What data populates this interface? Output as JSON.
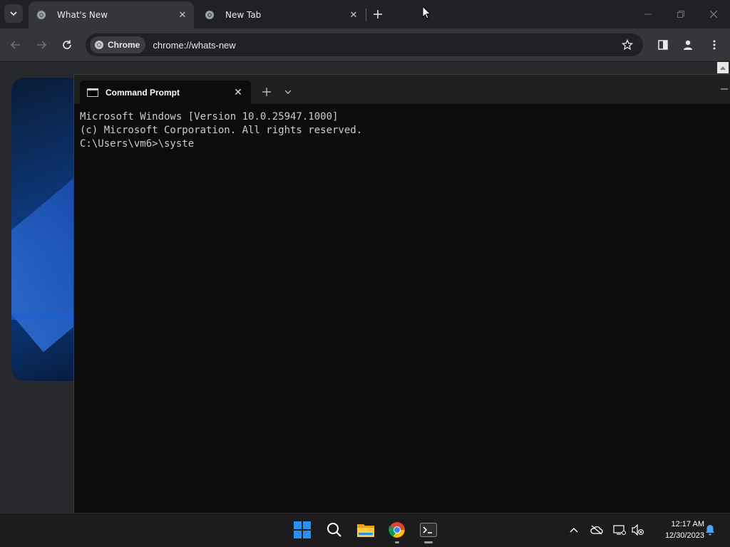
{
  "browser": {
    "tabs": [
      {
        "title": "What's New",
        "active": true
      },
      {
        "title": "New Tab",
        "active": false
      }
    ],
    "omnibox": {
      "chip_label": "Chrome",
      "url": "chrome://whats-new"
    }
  },
  "terminal": {
    "tab_title": "Command Prompt",
    "lines": [
      "Microsoft Windows [Version 10.0.25947.1000]",
      "(c) Microsoft Corporation. All rights reserved.",
      "",
      "C:\\Users\\vm6>\\syste"
    ]
  },
  "taskbar": {
    "apps": [
      "start-icon",
      "search-icon",
      "file-explorer-icon",
      "chrome-icon",
      "terminal-icon"
    ],
    "clock": {
      "time": "12:17 AM",
      "date": "12/30/2023"
    }
  },
  "colors": {
    "chrome_dark": "#202124",
    "toolbar": "#35363a",
    "terminal_bg": "#0c0c0c",
    "taskbar": "#1c1c1c",
    "windows_blue": "#2b8ef0"
  }
}
